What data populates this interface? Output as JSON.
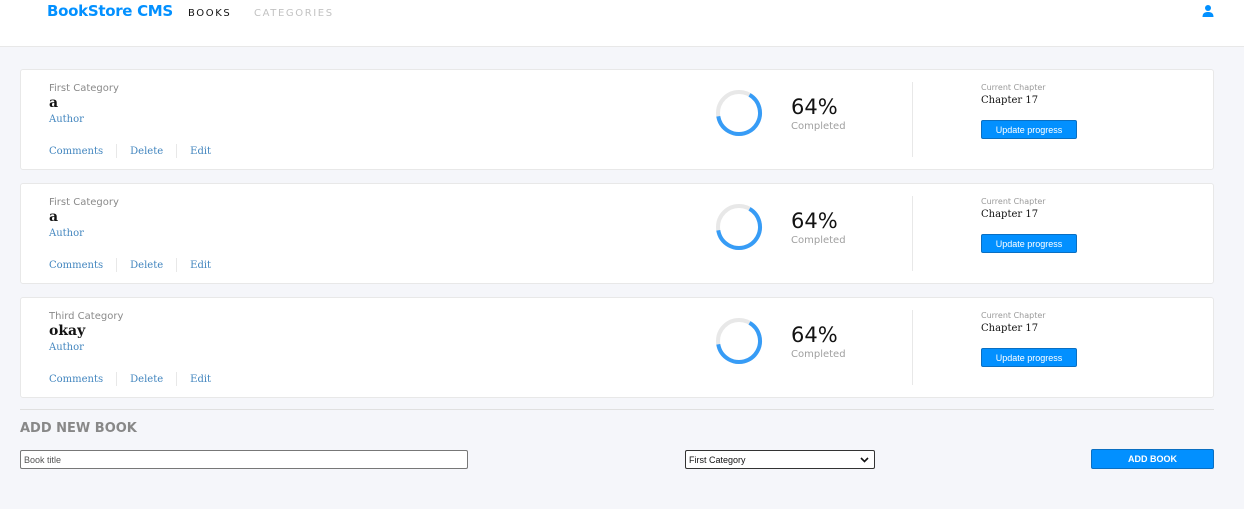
{
  "header": {
    "brand": "BookStore CMS",
    "nav": {
      "books": "BOOKS",
      "categories": "CATEGORIES"
    },
    "user_icon": "user-icon"
  },
  "colors": {
    "accent": "#0290ff",
    "link": "#4386bf",
    "ring_track": "#e8e8e8",
    "ring_fill": "#379cf6"
  },
  "books": [
    {
      "category": "First Category",
      "title": "a",
      "author": "Author",
      "actions": {
        "comments": "Comments",
        "delete": "Delete",
        "edit": "Edit"
      },
      "progress": {
        "percent_text": "64%",
        "percent": 64,
        "completed_label": "Completed"
      },
      "chapter": {
        "label": "Current Chapter",
        "value": "Chapter 17"
      },
      "update_label": "Update progress"
    },
    {
      "category": "First Category",
      "title": "a",
      "author": "Author",
      "actions": {
        "comments": "Comments",
        "delete": "Delete",
        "edit": "Edit"
      },
      "progress": {
        "percent_text": "64%",
        "percent": 64,
        "completed_label": "Completed"
      },
      "chapter": {
        "label": "Current Chapter",
        "value": "Chapter 17"
      },
      "update_label": "Update progress"
    },
    {
      "category": "Third Category",
      "title": "okay",
      "author": "Author",
      "actions": {
        "comments": "Comments",
        "delete": "Delete",
        "edit": "Edit"
      },
      "progress": {
        "percent_text": "64%",
        "percent": 64,
        "completed_label": "Completed"
      },
      "chapter": {
        "label": "Current Chapter",
        "value": "Chapter 17"
      },
      "update_label": "Update progress"
    }
  ],
  "add_book": {
    "heading": "ADD NEW BOOK",
    "title_placeholder": "Book title",
    "category_selected": "First Category",
    "submit_label": "ADD BOOK"
  }
}
